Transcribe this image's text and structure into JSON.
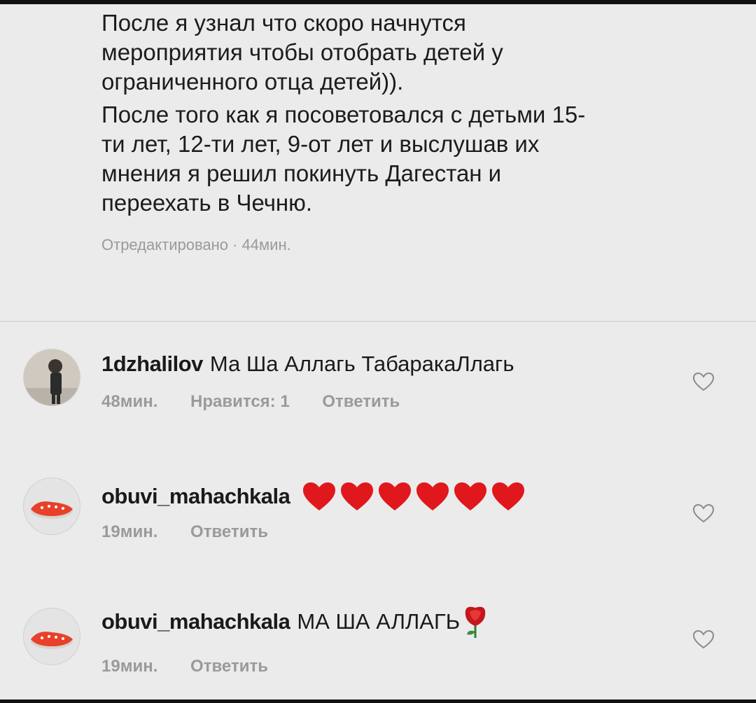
{
  "main_comment": {
    "paragraph1": [
      "После я узнал что скоро начнутся",
      "мероприятия чтобы отобрать детей у",
      "ограниченного отца детей))."
    ],
    "paragraph2": [
      "После того как я посоветовался с детьми 15-",
      "ти лет, 12-ти лет, 9-от лет и выслушав их",
      "мнения я решил покинуть Дагестан и",
      "переехать в Чечню."
    ],
    "meta": "Отредактировано · 44мин."
  },
  "replies": [
    {
      "username": "1dzhalilov",
      "text": "Ма Ша Аллагь ТабаракаЛлагь",
      "time": "48мин.",
      "likes": "Нравится: 1",
      "reply_label": "Ответить",
      "avatar_icon": "person-photo-avatar"
    },
    {
      "username": "obuvi_mahachkala",
      "text": "",
      "emoji": "red-heart x6",
      "time": "19мин.",
      "reply_label": "Ответить",
      "avatar_icon": "red-shoes-avatar"
    },
    {
      "username": "obuvi_mahachkala",
      "text": "МА ША АЛЛАГЬ",
      "emoji": "rose",
      "time": "19мин.",
      "reply_label": "Ответить",
      "avatar_icon": "red-shoes-avatar"
    }
  ],
  "colors": {
    "background": "#ebebeb",
    "meta_text": "#9a9a9a",
    "heart_emoji": "#e0181e"
  }
}
